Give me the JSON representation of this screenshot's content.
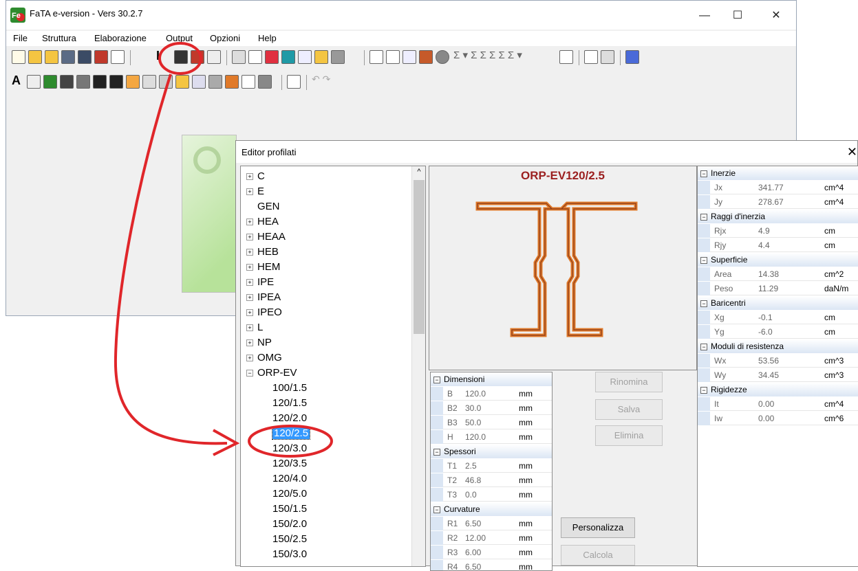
{
  "app": {
    "title": "FaTA e-version - Vers 30.2.7",
    "logo_text": "Fe",
    "controls": {
      "minimize": "—",
      "maximize": "☐",
      "close": "✕"
    }
  },
  "menu": [
    "File",
    "Struttura",
    "Elaborazione",
    "Output",
    "Opzioni",
    "Help"
  ],
  "dialog": {
    "title": "Editor profilati",
    "close": "✕",
    "scroll_up": "^"
  },
  "tree": {
    "plus": "+",
    "minus": "−",
    "items": [
      {
        "label": "C"
      },
      {
        "label": "E"
      },
      {
        "label": "GEN"
      },
      {
        "label": "HEA"
      },
      {
        "label": "HEAA"
      },
      {
        "label": "HEB"
      },
      {
        "label": "HEM"
      },
      {
        "label": "IPE"
      },
      {
        "label": "IPEA"
      },
      {
        "label": "IPEO"
      },
      {
        "label": "L"
      },
      {
        "label": "NP"
      },
      {
        "label": "OMG"
      },
      {
        "label": "ORP-EV"
      }
    ],
    "children": [
      "100/1.5",
      "120/1.5",
      "120/2.0",
      "120/2.5",
      "120/3.0",
      "120/3.5",
      "120/4.0",
      "120/5.0",
      "150/1.5",
      "150/2.0",
      "150/2.5",
      "150/3.0"
    ],
    "selected": "120/2.5"
  },
  "section": {
    "title": "ORP-EV120/2.5"
  },
  "dimensions": {
    "groups": [
      {
        "name": "Dimensioni",
        "rows": [
          {
            "k": "B",
            "v": "120.0",
            "u": "mm"
          },
          {
            "k": "B2",
            "v": "30.0",
            "u": "mm"
          },
          {
            "k": "B3",
            "v": "50.0",
            "u": "mm"
          },
          {
            "k": "H",
            "v": "120.0",
            "u": "mm"
          }
        ]
      },
      {
        "name": "Spessori",
        "rows": [
          {
            "k": "T1",
            "v": "2.5",
            "u": "mm"
          },
          {
            "k": "T2",
            "v": "46.8",
            "u": "mm"
          },
          {
            "k": "T3",
            "v": "0.0",
            "u": "mm"
          }
        ]
      },
      {
        "name": "Curvature",
        "rows": [
          {
            "k": "R1",
            "v": "6.50",
            "u": "mm"
          },
          {
            "k": "R2",
            "v": "12.00",
            "u": "mm"
          },
          {
            "k": "R3",
            "v": "6.00",
            "u": "mm"
          },
          {
            "k": "R4",
            "v": "6.50",
            "u": "mm"
          }
        ]
      }
    ]
  },
  "properties": {
    "groups": [
      {
        "name": "Inerzie",
        "rows": [
          {
            "k": "Jx",
            "v": "341.77",
            "u": "cm^4"
          },
          {
            "k": "Jy",
            "v": "278.67",
            "u": "cm^4"
          }
        ]
      },
      {
        "name": "Raggi d'inerzia",
        "rows": [
          {
            "k": "Rjx",
            "v": "4.9",
            "u": "cm"
          },
          {
            "k": "Rjy",
            "v": "4.4",
            "u": "cm"
          }
        ]
      },
      {
        "name": "Superficie",
        "rows": [
          {
            "k": "Area",
            "v": "14.38",
            "u": "cm^2"
          },
          {
            "k": "Peso",
            "v": "11.29",
            "u": "daN/m"
          }
        ]
      },
      {
        "name": "Baricentri",
        "rows": [
          {
            "k": "Xg",
            "v": "-0.1",
            "u": "cm"
          },
          {
            "k": "Yg",
            "v": "-6.0",
            "u": "cm"
          }
        ]
      },
      {
        "name": "Moduli di resistenza",
        "rows": [
          {
            "k": "Wx",
            "v": "53.56",
            "u": "cm^3"
          },
          {
            "k": "Wy",
            "v": "34.45",
            "u": "cm^3"
          }
        ]
      },
      {
        "name": "Rigidezze",
        "rows": [
          {
            "k": "It",
            "v": "0.00",
            "u": "cm^4"
          },
          {
            "k": "Iw",
            "v": "0.00",
            "u": "cm^6"
          }
        ]
      }
    ]
  },
  "buttons": {
    "rinomina": "Rinomina",
    "salva": "Salva",
    "elimina": "Elimina",
    "personalizza": "Personalizza",
    "calcola": "Calcola"
  },
  "colors": {
    "annotation": "#e0262a",
    "selection": "#3399ff",
    "profile_outer": "#e07a2a",
    "profile_inner": "#8a3a1a",
    "title_text": "#9b2020"
  }
}
